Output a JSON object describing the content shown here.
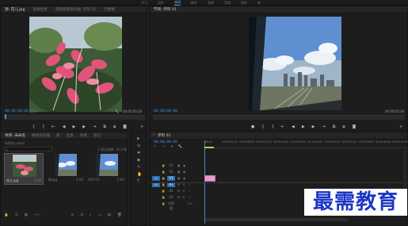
{
  "topbar": {
    "workspaces": [
      "学习",
      "组件",
      "编辑",
      "颜色",
      "效果",
      "音频",
      "图形",
      "库"
    ],
    "active_index": 2
  },
  "source_panel": {
    "tabs": [
      "源: 花儿.jpg",
      "效果控件",
      "音频剪辑混合器: 序列 01",
      "元数据"
    ],
    "timecode_left": "00;00;00;00",
    "fit_label": "适合",
    "timecode_right": "00;00;05;00",
    "controls": [
      "⏮",
      "◀",
      "▶",
      "▶▶",
      "⏭",
      "↔",
      "⧉",
      "📷",
      "⚙"
    ]
  },
  "program_panel": {
    "tabs": [
      "节目: 序列 01"
    ],
    "timecode_left": "00;00;00;00",
    "fit_label": "适合",
    "scale_label": "完整",
    "timecode_right": "00;00;05;00",
    "controls": [
      "◆",
      "◀",
      "⏮",
      "◀",
      "▶",
      "▶▶",
      "⏭",
      "⧉",
      "⧉",
      "📷",
      "⚙"
    ]
  },
  "project_panel": {
    "tabs": [
      "项目: 未命名",
      "媒体浏览器",
      "库",
      "信息",
      "效果",
      "标记"
    ],
    "project_file": "未命名.prproj",
    "search_placeholder": "",
    "item_count": "1 项已选择，共 3 项",
    "items": [
      {
        "name": "花儿.jpg",
        "duration": "5:00",
        "selected": true
      },
      {
        "name": "楼.jpg",
        "duration": "5:00",
        "selected": false
      },
      {
        "name": "序列 01",
        "duration": "5:00",
        "selected": false
      }
    ]
  },
  "tools": [
    "▶",
    "⇆",
    "✥",
    "◆",
    "✎",
    "✋",
    "T"
  ],
  "timeline_panel": {
    "tabs": [
      "序列 01"
    ],
    "timecode": "00;00;00;00",
    "ruler_ticks": [
      "00;00",
      "00;00;04;00",
      "00;00;08;00",
      "00;00;12;00",
      "00;00;16;00",
      "00;00;20;00",
      "00;00;24;00",
      "00;00;28;00",
      "00;00;32;00",
      "00;00;36;00",
      "00;00;40;00",
      "00;00;44;00"
    ],
    "tracks": [
      {
        "name": "V3",
        "kind": "video"
      },
      {
        "name": "V2",
        "kind": "video"
      },
      {
        "name": "V1",
        "kind": "video",
        "target": "V1"
      },
      {
        "name": "A1",
        "kind": "audio",
        "target": "A1"
      },
      {
        "name": "A2",
        "kind": "audio"
      },
      {
        "name": "A3",
        "kind": "audio"
      },
      {
        "name": "主声道",
        "kind": "master",
        "value": "0.0"
      }
    ]
  },
  "watermark": "最需教育",
  "colors": {
    "accent": "#3d8fd9",
    "clip": "#e79ad2",
    "watermark": "#1c36c6"
  }
}
